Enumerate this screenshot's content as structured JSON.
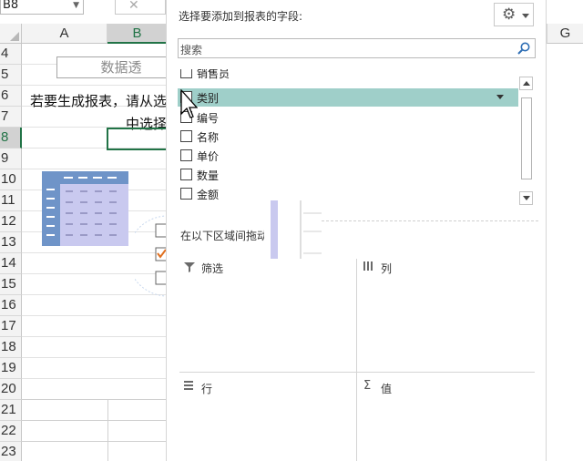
{
  "sheet": {
    "name_box": "B8",
    "fx_cancel": "✕",
    "columns": [
      {
        "label": "A",
        "selected": false
      },
      {
        "label": "B",
        "selected": true
      },
      {
        "label": "G",
        "selected": false
      }
    ],
    "rows": [
      {
        "label": "4"
      },
      {
        "label": "5"
      },
      {
        "label": "6"
      },
      {
        "label": "7"
      },
      {
        "label": "8",
        "selected": true
      },
      {
        "label": "9"
      },
      {
        "label": "10"
      },
      {
        "label": "11"
      },
      {
        "label": "12"
      },
      {
        "label": "13"
      },
      {
        "label": "14"
      },
      {
        "label": "15"
      },
      {
        "label": "16"
      },
      {
        "label": "17"
      },
      {
        "label": "18"
      },
      {
        "label": "19"
      },
      {
        "label": "20"
      },
      {
        "label": "21"
      },
      {
        "label": "22"
      },
      {
        "label": "23"
      }
    ],
    "pivot_placeholder": {
      "title": "数据透",
      "text_line1": "若要生成报表，请从选",
      "text_line2": "中选择"
    }
  },
  "pane": {
    "title": "选择要添加到报表的字段:",
    "tools_icon": "gear-icon",
    "search_placeholder": "搜索",
    "fields": [
      {
        "label": "销售员",
        "checked": false
      },
      {
        "label": "类别",
        "checked": false,
        "highlighted": true
      },
      {
        "label": "编号",
        "checked": false
      },
      {
        "label": "名称",
        "checked": false
      },
      {
        "label": "单价",
        "checked": false
      },
      {
        "label": "数量",
        "checked": false
      },
      {
        "label": "金额",
        "checked": false
      }
    ],
    "areas_label": "在以下区域间拖动字段",
    "areas": {
      "filters": "筛选",
      "columns": "列",
      "rows": "行",
      "values": "值"
    }
  },
  "colors": {
    "accent": "#217346",
    "highlight": "#9fcfc9",
    "pivot_icon_blue": "#6f94c8",
    "pivot_icon_lavender": "#c9c9ef"
  }
}
